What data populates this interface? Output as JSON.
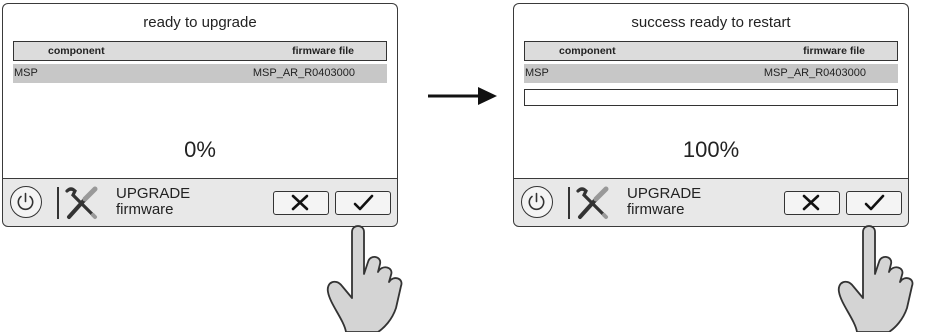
{
  "panels": [
    {
      "title": "ready to upgrade",
      "table": {
        "headers": [
          "component",
          "firmware file"
        ],
        "rows": [
          [
            "MSP",
            "MSP_AR_R0403000"
          ]
        ]
      },
      "progress_bar_visible": false,
      "progress_fraction": 0,
      "percent_text": "0%",
      "bar_label_line1": "UPGRADE",
      "bar_label_line2": "firmware",
      "icons": [
        "power-icon",
        "tools-icon",
        "close-icon",
        "check-icon"
      ]
    },
    {
      "title": "success ready to restart",
      "table": {
        "headers": [
          "component",
          "firmware file"
        ],
        "rows": [
          [
            "MSP",
            "MSP_AR_R0403000"
          ]
        ]
      },
      "progress_bar_visible": true,
      "progress_fraction": 1,
      "percent_text": "100%",
      "bar_label_line1": "UPGRADE",
      "bar_label_line2": "firmware",
      "icons": [
        "power-icon",
        "tools-icon",
        "close-icon",
        "check-icon"
      ]
    }
  ],
  "colors": {
    "header_bg": "#dcdcdc",
    "row_bg": "#c7c7c7",
    "bar_bg": "#e8e8e8",
    "outline": "#333333",
    "hand_fill": "#d4d4d4"
  }
}
